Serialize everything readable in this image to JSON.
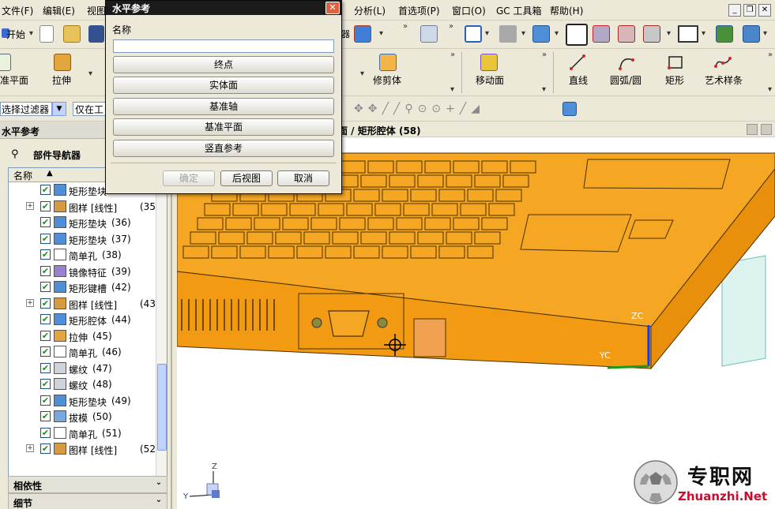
{
  "menu": {
    "file": "文件(F)",
    "edit": "编辑(E)",
    "view": "视图",
    "analysis": "分析(L)",
    "preferences": "首选项(P)",
    "window": "窗口(O)",
    "gc_toolbox": "GC 工具箱",
    "help": "帮助(H)"
  },
  "window_controls": {
    "minimize": "_",
    "restore": "❐",
    "close": "✕"
  },
  "toolbar1": {
    "start_label": "开始"
  },
  "toolbar2": {
    "datum_plane": "准平面",
    "extrude": "拉伸",
    "trim_body": "修剪体",
    "move_face": "移动面",
    "line": "直线",
    "arc_circle": "圆弧/圆",
    "rectangle": "矩形",
    "studio_spline": "艺术样条"
  },
  "filterbar": {
    "filter_label": "选择过滤器",
    "scope_value": "仅在工"
  },
  "left_panel": {
    "title": "水平参考",
    "navigator_title": "部件导航器",
    "column_name": "名称",
    "sections": {
      "dependencies": "相依性",
      "details": "细节"
    }
  },
  "tree_items": [
    {
      "label": "矩形垫块",
      "num": "",
      "expand": false,
      "icon": "pad"
    },
    {
      "label": "图样 [线性]",
      "num": "(35)",
      "expand": true,
      "icon": "pattern"
    },
    {
      "label": "矩形垫块",
      "num": "(36)",
      "expand": false,
      "icon": "pad"
    },
    {
      "label": "矩形垫块",
      "num": "(37)",
      "expand": false,
      "icon": "pad"
    },
    {
      "label": "简单孔",
      "num": "(38)",
      "expand": false,
      "icon": "hole"
    },
    {
      "label": "镜像特征",
      "num": "(39)",
      "expand": false,
      "icon": "mirror"
    },
    {
      "label": "矩形键槽",
      "num": "(42)",
      "expand": false,
      "icon": "slot"
    },
    {
      "label": "图样 [线性]",
      "num": "(43)",
      "expand": true,
      "icon": "pattern"
    },
    {
      "label": "矩形腔体",
      "num": "(44)",
      "expand": false,
      "icon": "pocket"
    },
    {
      "label": "拉伸",
      "num": "(45)",
      "expand": false,
      "icon": "extrude"
    },
    {
      "label": "简单孔",
      "num": "(46)",
      "expand": false,
      "icon": "hole"
    },
    {
      "label": "螺纹",
      "num": "(47)",
      "expand": false,
      "icon": "thread"
    },
    {
      "label": "螺纹",
      "num": "(48)",
      "expand": false,
      "icon": "thread"
    },
    {
      "label": "矩形垫块",
      "num": "(49)",
      "expand": false,
      "icon": "pad"
    },
    {
      "label": "拔模",
      "num": "(50)",
      "expand": false,
      "icon": "draft"
    },
    {
      "label": "简单孔",
      "num": "(51)",
      "expand": false,
      "icon": "hole"
    },
    {
      "label": "图样 [线性]",
      "num": "(52)",
      "expand": true,
      "icon": "pattern"
    }
  ],
  "viewport": {
    "title_prefix": "面 /",
    "title_feature": "矩形腔体",
    "title_num": "(58)",
    "axis_zc": "ZC",
    "axis_yc": "YC",
    "triad_z": "Z",
    "triad_y": "Y"
  },
  "dialog": {
    "title": "水平参考",
    "name_label": "名称",
    "name_value": "",
    "buttons": [
      "终点",
      "实体面",
      "基准轴",
      "基准平面",
      "竖直参考"
    ],
    "ok": "确定",
    "back": "后视图",
    "cancel": "取消"
  },
  "watermark": {
    "brand": "专职网",
    "site": "Zhuanzhi.Net"
  },
  "colors": {
    "part_orange": "#f5a623",
    "edge_dark": "#4a3000",
    "dialog_title_bg": "#1b1b1b",
    "checkmark": "#1a8c1a",
    "watermark_red": "#c8102e",
    "axis_blue": "#0a3cff"
  }
}
